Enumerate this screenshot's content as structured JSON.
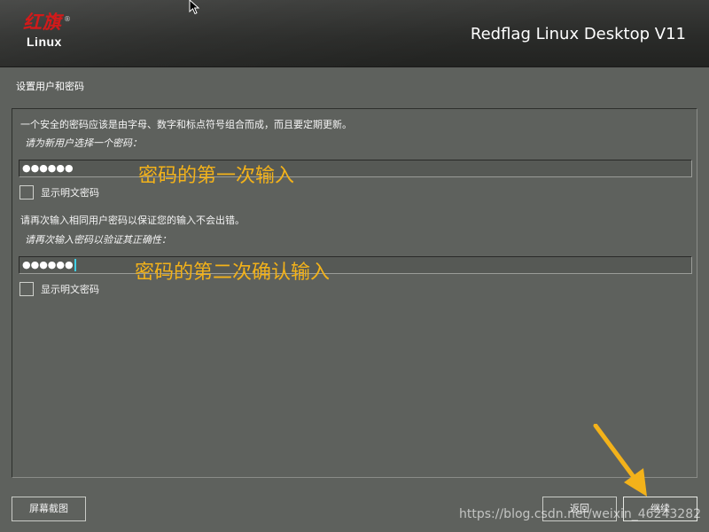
{
  "header": {
    "logo_cn": "红旗",
    "logo_reg": "®",
    "logo_en": "Linux",
    "product_title": "Redflag Linux Desktop V11"
  },
  "page": {
    "title": "设置用户和密码"
  },
  "form": {
    "intro": "一个安全的密码应该是由字母、数字和标点符号组合而成，而且要定期更新。",
    "password_prompt": "请为新用户选择一个密码：",
    "password_value": "●●●●●●",
    "show_plain_label": "显示明文密码",
    "confirm_intro": "请再次输入相同用户密码以保证您的输入不会出错。",
    "confirm_prompt": "请再次输入密码以验证其正确性：",
    "confirm_value": "●●●●●●",
    "show_plain_label_2": "显示明文密码"
  },
  "annotations": {
    "first": "密码的第一次输入",
    "second": "密码的第二次确认输入",
    "color": "#f3b21a"
  },
  "buttons": {
    "screenshot": "屏幕截图",
    "back": "返回",
    "next": "继续"
  },
  "watermark": "https://blog.csdn.net/weixin_46243282",
  "icons": {
    "cursor": "mouse-pointer-icon",
    "arrow": "annotation-arrow-icon",
    "checkbox": "checkbox-icon"
  },
  "colors": {
    "background": "#5e615d",
    "header": "#2a2b29",
    "logo_red": "#d21a1a",
    "caret": "#3fd0e6"
  }
}
